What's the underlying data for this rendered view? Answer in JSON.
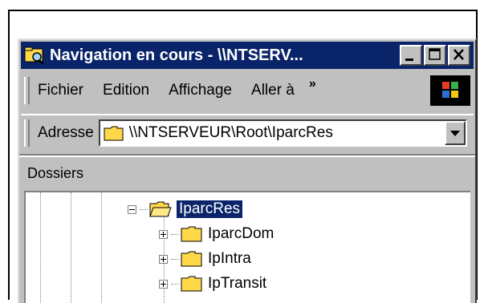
{
  "window": {
    "title": "Navigation en cours - \\\\NTSERV..."
  },
  "menu": {
    "items": [
      "Fichier",
      "Edition",
      "Affichage",
      "Aller à"
    ],
    "more": "»"
  },
  "address": {
    "label": "Adresse",
    "value": "\\\\NTSERVEUR\\Root\\IparcRes"
  },
  "panel": {
    "title": "Dossiers"
  },
  "tree": {
    "root": {
      "label": "IparcRes",
      "expanded": true,
      "selected": true
    },
    "children": [
      {
        "label": "IparcDom",
        "expanded": false
      },
      {
        "label": "IpIntra",
        "expanded": false
      },
      {
        "label": "IpTransit",
        "expanded": false
      }
    ]
  },
  "icons": {
    "title": "explorer-folder-icon",
    "folder": "folder-icon",
    "open_folder": "open-folder-icon",
    "windows_logo": "windows-logo-icon"
  },
  "colors": {
    "titlebar": "#0a246a",
    "chrome": "#c0c0c0",
    "folder": "#ffd84a",
    "selection": "#0a246a"
  }
}
